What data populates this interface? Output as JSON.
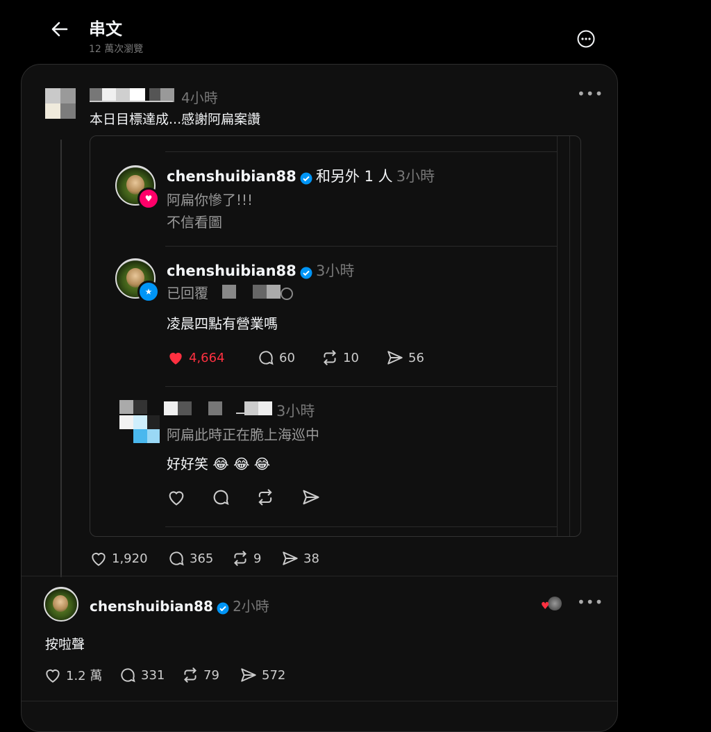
{
  "header": {
    "title": "串文",
    "views": "12 萬次瀏覽"
  },
  "post": {
    "time": "4小時",
    "text": "本日目標達成...感謝阿扁案讚",
    "actions": {
      "like": "1,920",
      "reply": "365",
      "repost": "9",
      "share": "38"
    }
  },
  "quoted": {
    "first": {
      "username": "chenshuibian88",
      "with_others": "和另外 1 人",
      "time": "3小時",
      "line1": "阿扁你慘了!!!",
      "line2": "不信看圖"
    },
    "second": {
      "username": "chenshuibian88",
      "time": "3小時",
      "replied_prefix": "已回覆",
      "text": "凌晨四點有營業嗎",
      "actions": {
        "like": "4,664",
        "reply": "60",
        "repost": "10",
        "share": "56"
      }
    },
    "third": {
      "time": "3小時",
      "line1": "阿扁此時正在脆上海巡中",
      "line2": "好好笑 😂 😂 😂"
    }
  },
  "reply": {
    "username": "chenshuibian88",
    "time": "2小時",
    "text": "按啦聲",
    "actions": {
      "like": "1.2 萬",
      "reply": "331",
      "repost": "79",
      "share": "572"
    }
  },
  "colors": {
    "like_red": "#ff3040",
    "verified_blue": "#0095f6",
    "badge_pink": "#ff0069",
    "badge_blue": "#0095f6"
  }
}
